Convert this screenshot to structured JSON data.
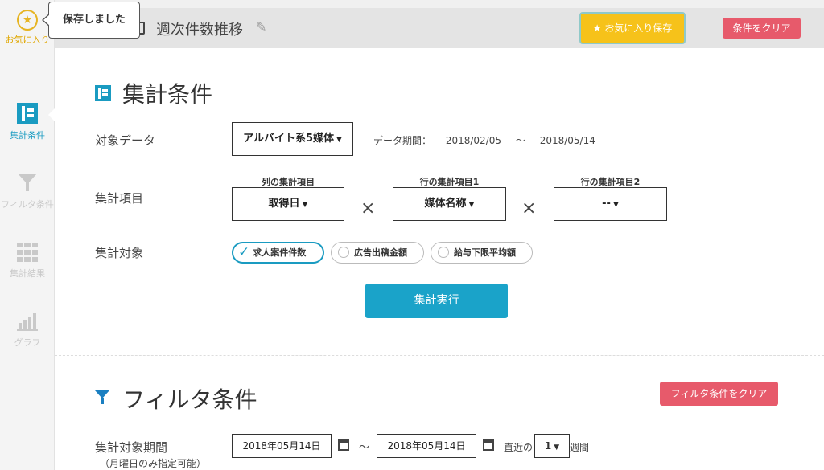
{
  "toast": {
    "text": "保存しました"
  },
  "sidebar": {
    "favorite_label": "お気に入り",
    "items": [
      {
        "label": "集計条件",
        "icon": "aggregation-conditions-icon",
        "active": true
      },
      {
        "label": "フィルタ条件",
        "icon": "filter-icon",
        "active": false
      },
      {
        "label": "集計結果",
        "icon": "grid-icon",
        "active": false
      },
      {
        "label": "グラフ",
        "icon": "bar-chart-icon",
        "active": false
      }
    ]
  },
  "header": {
    "title": "週次件数推移",
    "favorite_save_label": "★ お気に入り保存",
    "clear_label": "条件をクリア"
  },
  "conditions": {
    "title": "集計条件",
    "target_data_label": "対象データ",
    "target_data_value": "アルバイト系5媒体",
    "period_label": "データ期間：",
    "period_start": "2018/02/05",
    "period_sep": "～",
    "period_end": "2018/05/14",
    "items_label": "集計項目",
    "column_caption": "列の集計項目",
    "column_value": "取得日",
    "row1_caption": "行の集計項目1",
    "row1_value": "媒体名称",
    "row2_caption": "行の集計項目2",
    "row2_value": "--",
    "target_label": "集計対象",
    "targets": [
      {
        "label": "求人案件件数",
        "selected": true
      },
      {
        "label": "広告出稿金額",
        "selected": false
      },
      {
        "label": "給与下限平均額",
        "selected": false
      }
    ],
    "run_label": "集計実行"
  },
  "filters": {
    "title": "フィルタ条件",
    "clear_label": "フィルタ条件をクリア",
    "period_label": "集計対象期間",
    "period_note": "（月曜日のみ指定可能）",
    "start_date": "2018年05月14日",
    "date_sep": "～",
    "end_date": "2018年05月14日",
    "recent_prefix": "直近の",
    "recent_value": "1",
    "recent_suffix": "週間"
  },
  "colors": {
    "accent": "#1a9bc1",
    "favorite": "#f6c21a",
    "danger": "#e75a6b"
  }
}
